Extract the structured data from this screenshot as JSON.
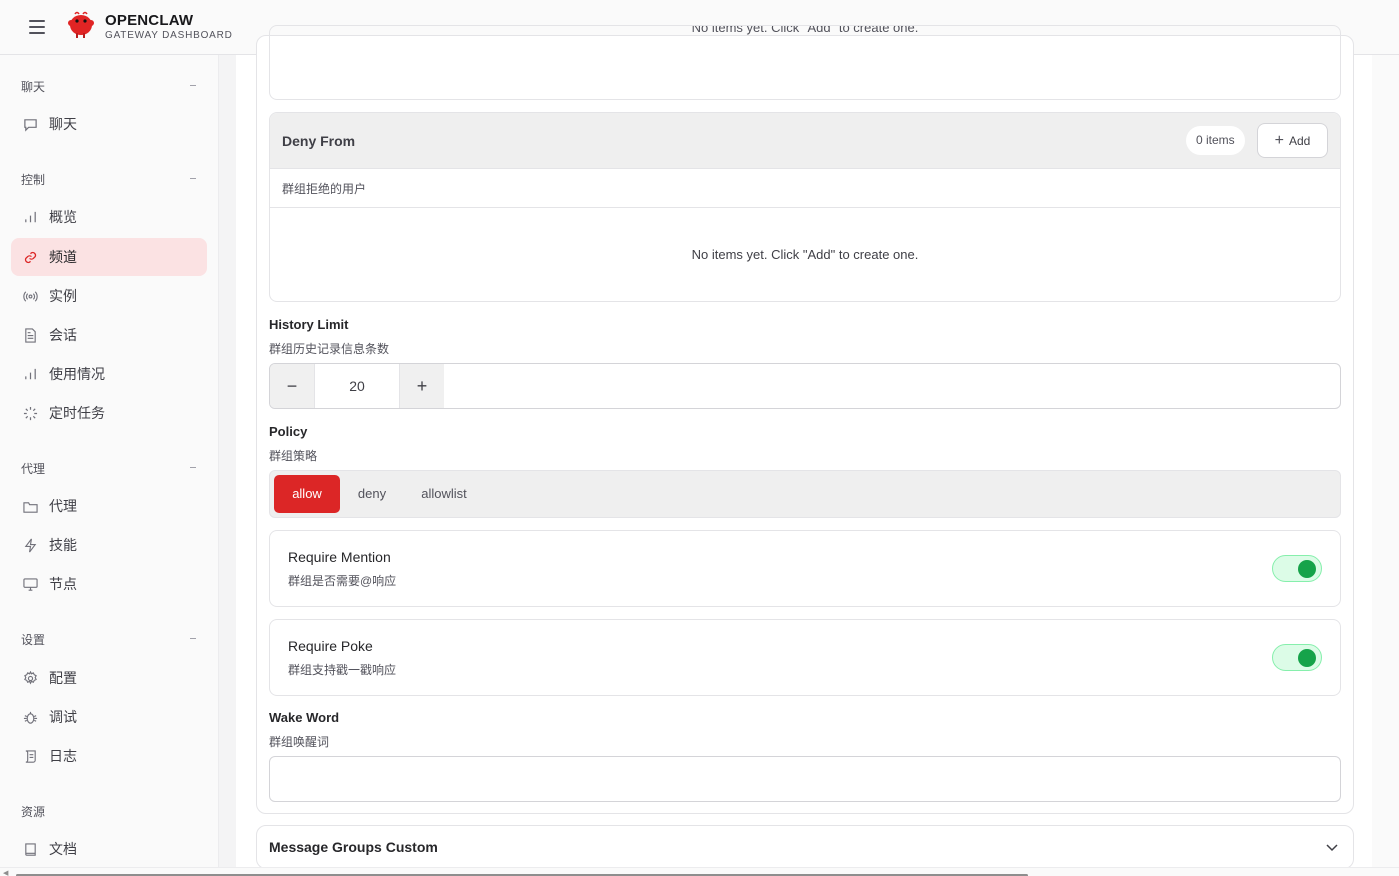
{
  "header": {
    "title": "OPENCLAW",
    "subtitle": "GATEWAY DASHBOARD"
  },
  "sidebar": {
    "groups": [
      {
        "label": "聊天",
        "items": [
          {
            "label": "聊天",
            "icon": "chat-icon"
          }
        ]
      },
      {
        "label": "控制",
        "items": [
          {
            "label": "概览",
            "icon": "bar-chart-icon"
          },
          {
            "label": "频道",
            "icon": "link-icon",
            "active": true
          },
          {
            "label": "实例",
            "icon": "broadcast-icon"
          },
          {
            "label": "会话",
            "icon": "document-icon"
          },
          {
            "label": "使用情况",
            "icon": "bar-chart-icon"
          },
          {
            "label": "定时任务",
            "icon": "loader-icon"
          }
        ]
      },
      {
        "label": "代理",
        "items": [
          {
            "label": "代理",
            "icon": "folder-icon"
          },
          {
            "label": "技能",
            "icon": "lightning-icon"
          },
          {
            "label": "节点",
            "icon": "monitor-icon"
          }
        ]
      },
      {
        "label": "设置",
        "items": [
          {
            "label": "配置",
            "icon": "gear-icon"
          },
          {
            "label": "调试",
            "icon": "bug-icon"
          },
          {
            "label": "日志",
            "icon": "scroll-icon"
          }
        ]
      },
      {
        "label": "资源",
        "items": [
          {
            "label": "文档",
            "icon": "book-icon"
          }
        ]
      }
    ]
  },
  "main": {
    "previous_list_empty": "No items yet. Click \"Add\" to create one.",
    "deny_from": {
      "title": "Deny From",
      "count": "0 items",
      "add_label": "Add",
      "description": "群组拒绝的用户",
      "empty": "No items yet. Click \"Add\" to create one."
    },
    "history_limit": {
      "label": "History Limit",
      "description": "群组历史记录信息条数",
      "value": "20",
      "minus": "−",
      "plus": "+"
    },
    "policy": {
      "label": "Policy",
      "description": "群组策略",
      "options": [
        "allow",
        "deny",
        "allowlist"
      ],
      "selected": "allow"
    },
    "require_mention": {
      "title": "Require Mention",
      "description": "群组是否需要@响应",
      "enabled": true
    },
    "require_poke": {
      "title": "Require Poke",
      "description": "群组支持戳一戳响应",
      "enabled": true
    },
    "wake_word": {
      "label": "Wake Word",
      "description": "群组唤醒词",
      "value": ""
    },
    "message_groups_custom": {
      "title": "Message Groups Custom"
    }
  },
  "colors": {
    "accent": "#dc2626",
    "active_nav_bg": "#fbe2e3",
    "toggle_on": "#16a34a"
  }
}
